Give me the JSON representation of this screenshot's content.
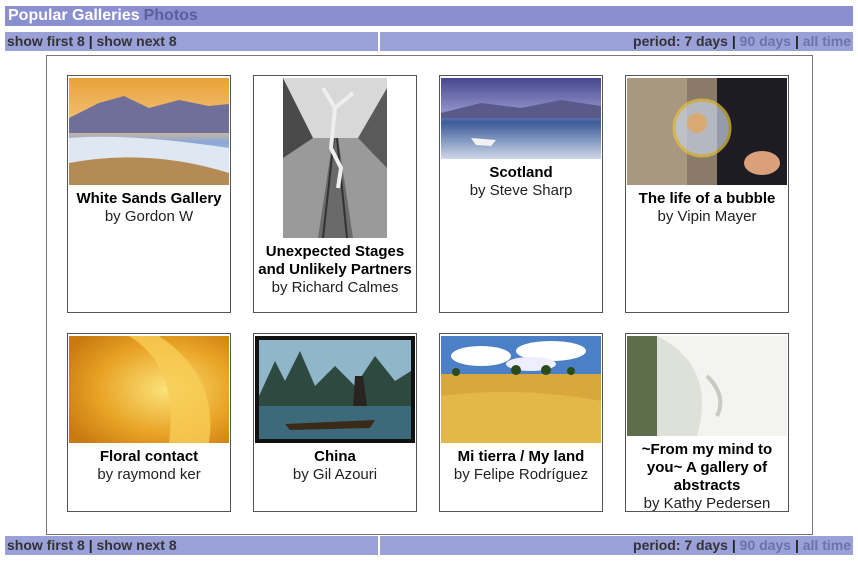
{
  "header": {
    "title": "Popular Galleries",
    "subtitle": "Photos"
  },
  "nav": {
    "show_first": "show first 8",
    "show_next": "show next 8",
    "period_label": "period: 7 days",
    "opt_90": "90 days",
    "opt_all": "all time",
    "sep": "|"
  },
  "galleries": [
    {
      "title": "White Sands Gallery",
      "author": "by Gordon W"
    },
    {
      "title": "Unexpected Stages and Unlikely Partners",
      "author": "by Richard Calmes"
    },
    {
      "title": "Scotland",
      "author": "by Steve Sharp"
    },
    {
      "title": "The life of a bubble",
      "author": "by Vipin Mayer"
    },
    {
      "title": "Floral contact",
      "author": "by raymond ker"
    },
    {
      "title": "China",
      "author": "by Gil Azouri"
    },
    {
      "title": "Mi tierra / My land",
      "author": "by Felipe Rodríguez"
    },
    {
      "title": "~From my mind to you~ A gallery of abstracts",
      "author": "by Kathy Pedersen"
    }
  ]
}
